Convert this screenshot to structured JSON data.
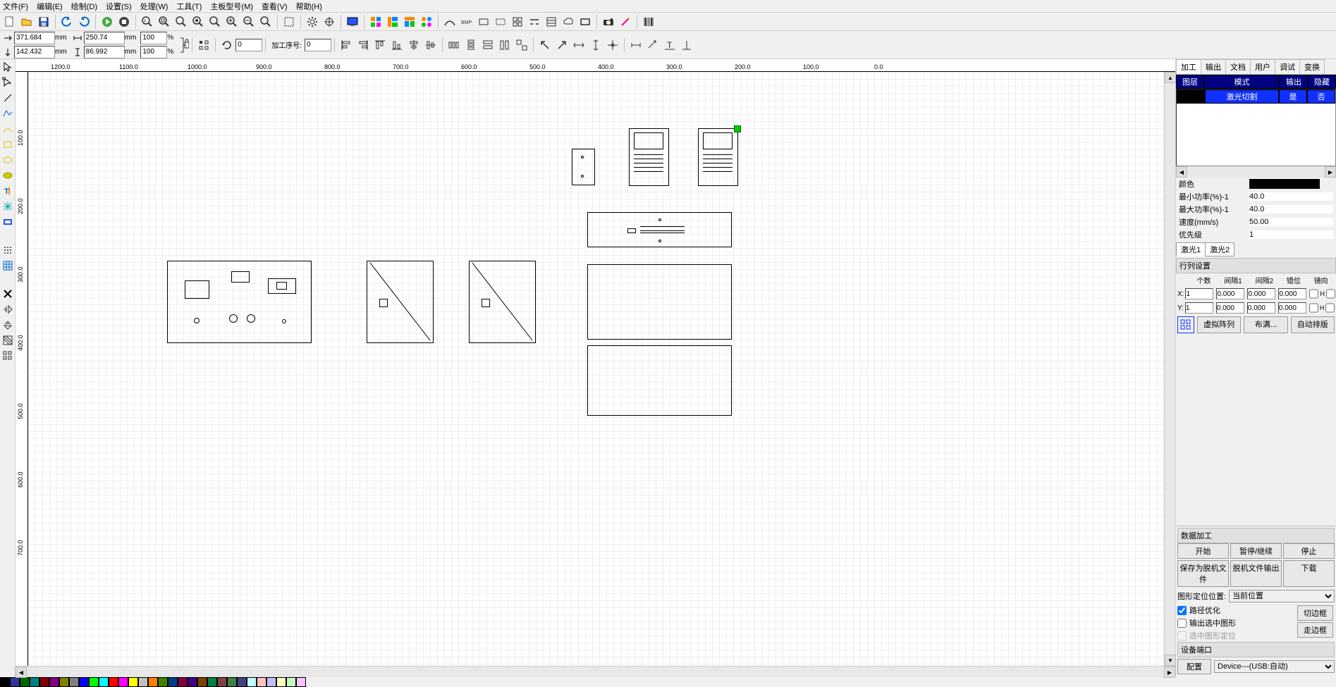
{
  "menu": [
    "文件(F)",
    "编辑(E)",
    "绘制(D)",
    "设置(S)",
    "处理(W)",
    "工具(T)",
    "主板型号(M)",
    "查看(V)",
    "帮助(H)"
  ],
  "coords": {
    "x": "371.684",
    "y": "142.432",
    "w": "250.74",
    "h": "86.992",
    "unit": "mm",
    "scaleX": "100",
    "scaleY": "100",
    "rot": "0",
    "job_label": "加工序号:",
    "job": "0"
  },
  "ruler_h": [
    "1200.0",
    "1100.0",
    "1000.0",
    "900.0",
    "800.0",
    "700.0",
    "600.0",
    "500.0",
    "400.0",
    "300.0",
    "200.0",
    "100.0",
    "0.0"
  ],
  "ruler_v": [
    "100.0",
    "200.0",
    "300.0",
    "400.0",
    "500.0",
    "600.0",
    "700.0"
  ],
  "panel": {
    "tabs": [
      "加工",
      "输出",
      "文档",
      "用户",
      "调试",
      "变换"
    ],
    "layer_hdr": [
      "图层",
      "模式",
      "输出",
      "隐藏"
    ],
    "layer_row": [
      "",
      "激光切割",
      "是",
      "否"
    ],
    "props": {
      "color": "颜色",
      "minp": "最小功率(%)-1",
      "minp_v": "40.0",
      "maxp": "最大功率(%)-1",
      "maxp_v": "40.0",
      "speed": "速度(mm/s)",
      "speed_v": "50.00",
      "prio": "优先级",
      "prio_v": "1"
    },
    "laser_tabs": [
      "激光1",
      "激光2"
    ],
    "array": {
      "title": "行列设置",
      "hdr": [
        "个数",
        "间隔1",
        "间隔2",
        "错位",
        "镜向"
      ],
      "x": "1",
      "y": "1",
      "g1": "0.000",
      "g2": "0.000",
      "off": "0.000",
      "btn1": "虚拟阵列",
      "btn2": "布满...",
      "btn3": "自动排版"
    },
    "proc": {
      "title": "数据加工",
      "start": "开始",
      "pause": "暂停/继续",
      "stop": "停止",
      "saveoff": "保存为脱机文件",
      "offout": "脱机文件输出",
      "dl": "下载",
      "pos_label": "图形定位位置:",
      "pos_val": "当前位置",
      "opt": "路径优化",
      "sel": "输出选中图形",
      "selpos": "选中图形定位",
      "cut": "切边框",
      "walk": "走边框",
      "port_title": "设备端口",
      "cfg": "配置",
      "device": "Device---(USB:自动)"
    }
  },
  "palette": [
    "#000000",
    "#333399",
    "#006600",
    "#008080",
    "#800000",
    "#800080",
    "#808000",
    "#808080",
    "#0000ff",
    "#00ff00",
    "#00ffff",
    "#ff0000",
    "#ff00ff",
    "#ffff00",
    "#c0c0c0",
    "#ff8000",
    "#408000",
    "#004080",
    "#800040",
    "#400080",
    "#804000",
    "#008040",
    "#804040",
    "#408040",
    "#404080",
    "#c0ffff",
    "#ffc0c0",
    "#c0c0ff",
    "#ffffc0",
    "#c0ffc0",
    "#ffc0ff"
  ]
}
